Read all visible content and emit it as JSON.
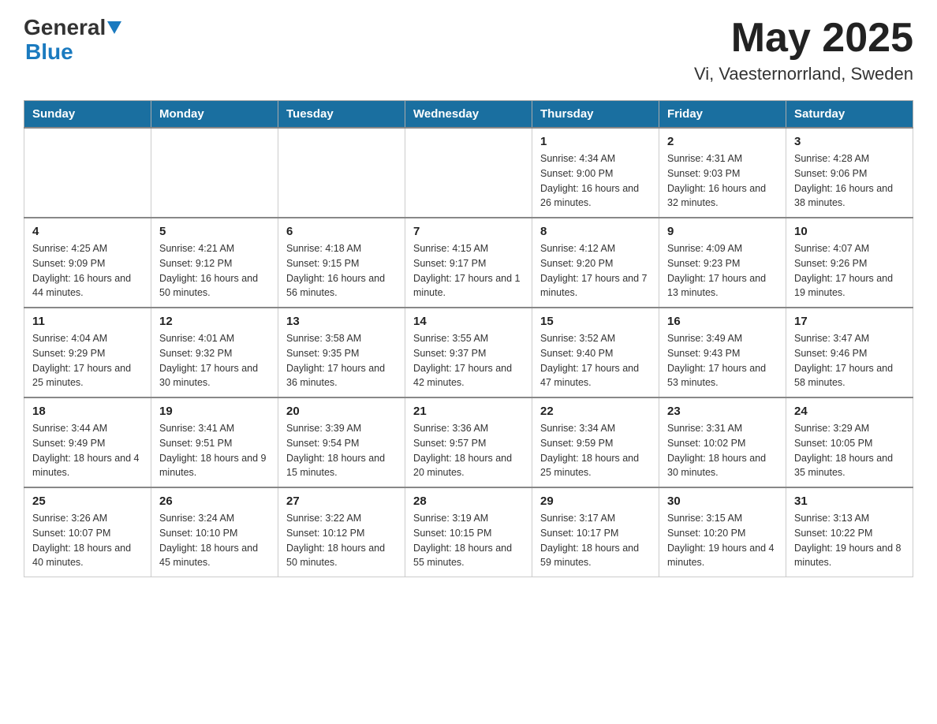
{
  "header": {
    "logo_general": "General",
    "logo_blue": "Blue",
    "month_year": "May 2025",
    "location": "Vi, Vaesternorrland, Sweden"
  },
  "days_of_week": [
    "Sunday",
    "Monday",
    "Tuesday",
    "Wednesday",
    "Thursday",
    "Friday",
    "Saturday"
  ],
  "weeks": [
    {
      "days": [
        {
          "num": "",
          "info": ""
        },
        {
          "num": "",
          "info": ""
        },
        {
          "num": "",
          "info": ""
        },
        {
          "num": "",
          "info": ""
        },
        {
          "num": "1",
          "info": "Sunrise: 4:34 AM\nSunset: 9:00 PM\nDaylight: 16 hours and 26 minutes."
        },
        {
          "num": "2",
          "info": "Sunrise: 4:31 AM\nSunset: 9:03 PM\nDaylight: 16 hours and 32 minutes."
        },
        {
          "num": "3",
          "info": "Sunrise: 4:28 AM\nSunset: 9:06 PM\nDaylight: 16 hours and 38 minutes."
        }
      ]
    },
    {
      "days": [
        {
          "num": "4",
          "info": "Sunrise: 4:25 AM\nSunset: 9:09 PM\nDaylight: 16 hours and 44 minutes."
        },
        {
          "num": "5",
          "info": "Sunrise: 4:21 AM\nSunset: 9:12 PM\nDaylight: 16 hours and 50 minutes."
        },
        {
          "num": "6",
          "info": "Sunrise: 4:18 AM\nSunset: 9:15 PM\nDaylight: 16 hours and 56 minutes."
        },
        {
          "num": "7",
          "info": "Sunrise: 4:15 AM\nSunset: 9:17 PM\nDaylight: 17 hours and 1 minute."
        },
        {
          "num": "8",
          "info": "Sunrise: 4:12 AM\nSunset: 9:20 PM\nDaylight: 17 hours and 7 minutes."
        },
        {
          "num": "9",
          "info": "Sunrise: 4:09 AM\nSunset: 9:23 PM\nDaylight: 17 hours and 13 minutes."
        },
        {
          "num": "10",
          "info": "Sunrise: 4:07 AM\nSunset: 9:26 PM\nDaylight: 17 hours and 19 minutes."
        }
      ]
    },
    {
      "days": [
        {
          "num": "11",
          "info": "Sunrise: 4:04 AM\nSunset: 9:29 PM\nDaylight: 17 hours and 25 minutes."
        },
        {
          "num": "12",
          "info": "Sunrise: 4:01 AM\nSunset: 9:32 PM\nDaylight: 17 hours and 30 minutes."
        },
        {
          "num": "13",
          "info": "Sunrise: 3:58 AM\nSunset: 9:35 PM\nDaylight: 17 hours and 36 minutes."
        },
        {
          "num": "14",
          "info": "Sunrise: 3:55 AM\nSunset: 9:37 PM\nDaylight: 17 hours and 42 minutes."
        },
        {
          "num": "15",
          "info": "Sunrise: 3:52 AM\nSunset: 9:40 PM\nDaylight: 17 hours and 47 minutes."
        },
        {
          "num": "16",
          "info": "Sunrise: 3:49 AM\nSunset: 9:43 PM\nDaylight: 17 hours and 53 minutes."
        },
        {
          "num": "17",
          "info": "Sunrise: 3:47 AM\nSunset: 9:46 PM\nDaylight: 17 hours and 58 minutes."
        }
      ]
    },
    {
      "days": [
        {
          "num": "18",
          "info": "Sunrise: 3:44 AM\nSunset: 9:49 PM\nDaylight: 18 hours and 4 minutes."
        },
        {
          "num": "19",
          "info": "Sunrise: 3:41 AM\nSunset: 9:51 PM\nDaylight: 18 hours and 9 minutes."
        },
        {
          "num": "20",
          "info": "Sunrise: 3:39 AM\nSunset: 9:54 PM\nDaylight: 18 hours and 15 minutes."
        },
        {
          "num": "21",
          "info": "Sunrise: 3:36 AM\nSunset: 9:57 PM\nDaylight: 18 hours and 20 minutes."
        },
        {
          "num": "22",
          "info": "Sunrise: 3:34 AM\nSunset: 9:59 PM\nDaylight: 18 hours and 25 minutes."
        },
        {
          "num": "23",
          "info": "Sunrise: 3:31 AM\nSunset: 10:02 PM\nDaylight: 18 hours and 30 minutes."
        },
        {
          "num": "24",
          "info": "Sunrise: 3:29 AM\nSunset: 10:05 PM\nDaylight: 18 hours and 35 minutes."
        }
      ]
    },
    {
      "days": [
        {
          "num": "25",
          "info": "Sunrise: 3:26 AM\nSunset: 10:07 PM\nDaylight: 18 hours and 40 minutes."
        },
        {
          "num": "26",
          "info": "Sunrise: 3:24 AM\nSunset: 10:10 PM\nDaylight: 18 hours and 45 minutes."
        },
        {
          "num": "27",
          "info": "Sunrise: 3:22 AM\nSunset: 10:12 PM\nDaylight: 18 hours and 50 minutes."
        },
        {
          "num": "28",
          "info": "Sunrise: 3:19 AM\nSunset: 10:15 PM\nDaylight: 18 hours and 55 minutes."
        },
        {
          "num": "29",
          "info": "Sunrise: 3:17 AM\nSunset: 10:17 PM\nDaylight: 18 hours and 59 minutes."
        },
        {
          "num": "30",
          "info": "Sunrise: 3:15 AM\nSunset: 10:20 PM\nDaylight: 19 hours and 4 minutes."
        },
        {
          "num": "31",
          "info": "Sunrise: 3:13 AM\nSunset: 10:22 PM\nDaylight: 19 hours and 8 minutes."
        }
      ]
    }
  ]
}
